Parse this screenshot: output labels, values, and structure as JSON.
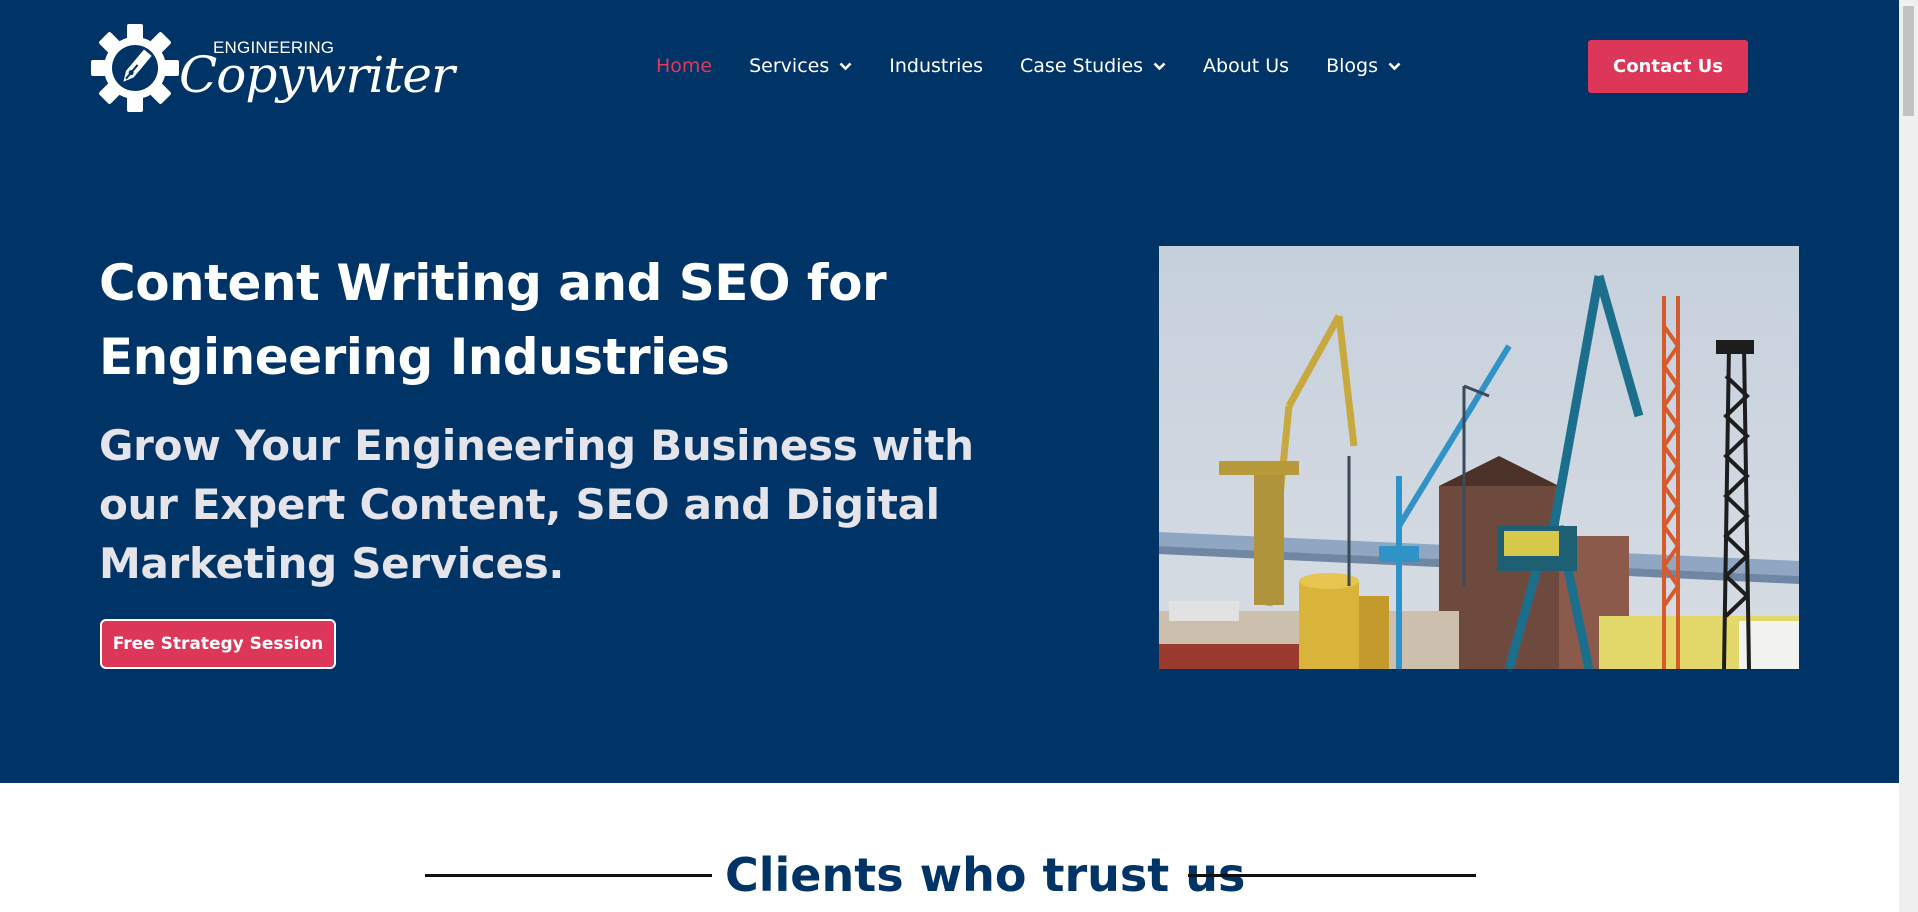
{
  "logo": {
    "top_text": "ENGINEERING",
    "main_text": "Copywriter",
    "icon": "gear-pen-icon"
  },
  "nav": {
    "items": [
      {
        "label": "Home",
        "active": true,
        "dropdown": false
      },
      {
        "label": "Services",
        "active": false,
        "dropdown": true
      },
      {
        "label": "Industries",
        "active": false,
        "dropdown": false
      },
      {
        "label": "Case Studies",
        "active": false,
        "dropdown": true
      },
      {
        "label": "About Us",
        "active": false,
        "dropdown": false
      },
      {
        "label": "Blogs",
        "active": false,
        "dropdown": true
      }
    ],
    "contact_label": "Contact Us"
  },
  "hero": {
    "title": "Content Writing and SEO for Engineering Industries",
    "subtitle": "Grow Your Engineering Business with our Expert Content, SEO and Digital Marketing Services.",
    "cta_label": "Free Strategy Session",
    "image_subject": "port cranes"
  },
  "clients": {
    "title": "Clients who trust us"
  },
  "colors": {
    "navy": "#003366",
    "accent": "#dc3658",
    "active_link": "#e0395f",
    "subtitle_text": "#e4e4ea"
  }
}
